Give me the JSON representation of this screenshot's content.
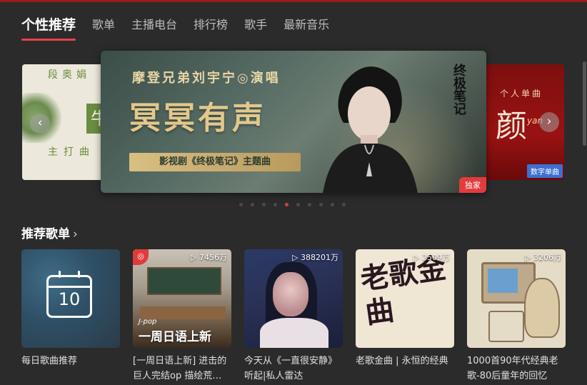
{
  "nav": {
    "tabs": [
      "个性推荐",
      "歌单",
      "主播电台",
      "排行榜",
      "歌手",
      "最新音乐"
    ],
    "active_index": 0
  },
  "banner": {
    "left_card": {
      "artist": "段奥娟",
      "title": "牛",
      "subtitle": "主打曲"
    },
    "main": {
      "artist_line": "摩登兄弟刘宇宁◎演唱",
      "title": "冥冥有声",
      "subtitle": "影视剧《终极笔记》主题曲",
      "calligraphy": "终极笔记",
      "badge": "独家"
    },
    "right_card": {
      "tag": "个人单曲",
      "title": "颜",
      "script": "yan",
      "badge": "数字单曲"
    },
    "prev_arrow": "‹",
    "next_arrow": "›",
    "dot_count": 10,
    "active_dot": 4,
    "accent_color": "#e03b3b"
  },
  "section": {
    "title": "推荐歌单",
    "chevron": "›",
    "playlists": [
      {
        "name": "每日歌曲推荐",
        "calendar_day": "10",
        "play_count": ""
      },
      {
        "name": "[一周日语上新] 进击的巨人完结op 描绘荒…",
        "play_count": "▷ 7456万",
        "cover_tag": "J-pop",
        "cover_title": "一周日语上新",
        "logo": "◎"
      },
      {
        "name": "今天从《一直很安静》听起|私人雷达",
        "play_count": "▷ 388201万"
      },
      {
        "name": "老歌金曲 | 永恒的经典",
        "play_count": "▷ 2509万",
        "cover_title": "老歌金曲"
      },
      {
        "name": "1000首90年代经典老歌-80后童年的回忆",
        "play_count": "▷ 3206万"
      }
    ]
  }
}
